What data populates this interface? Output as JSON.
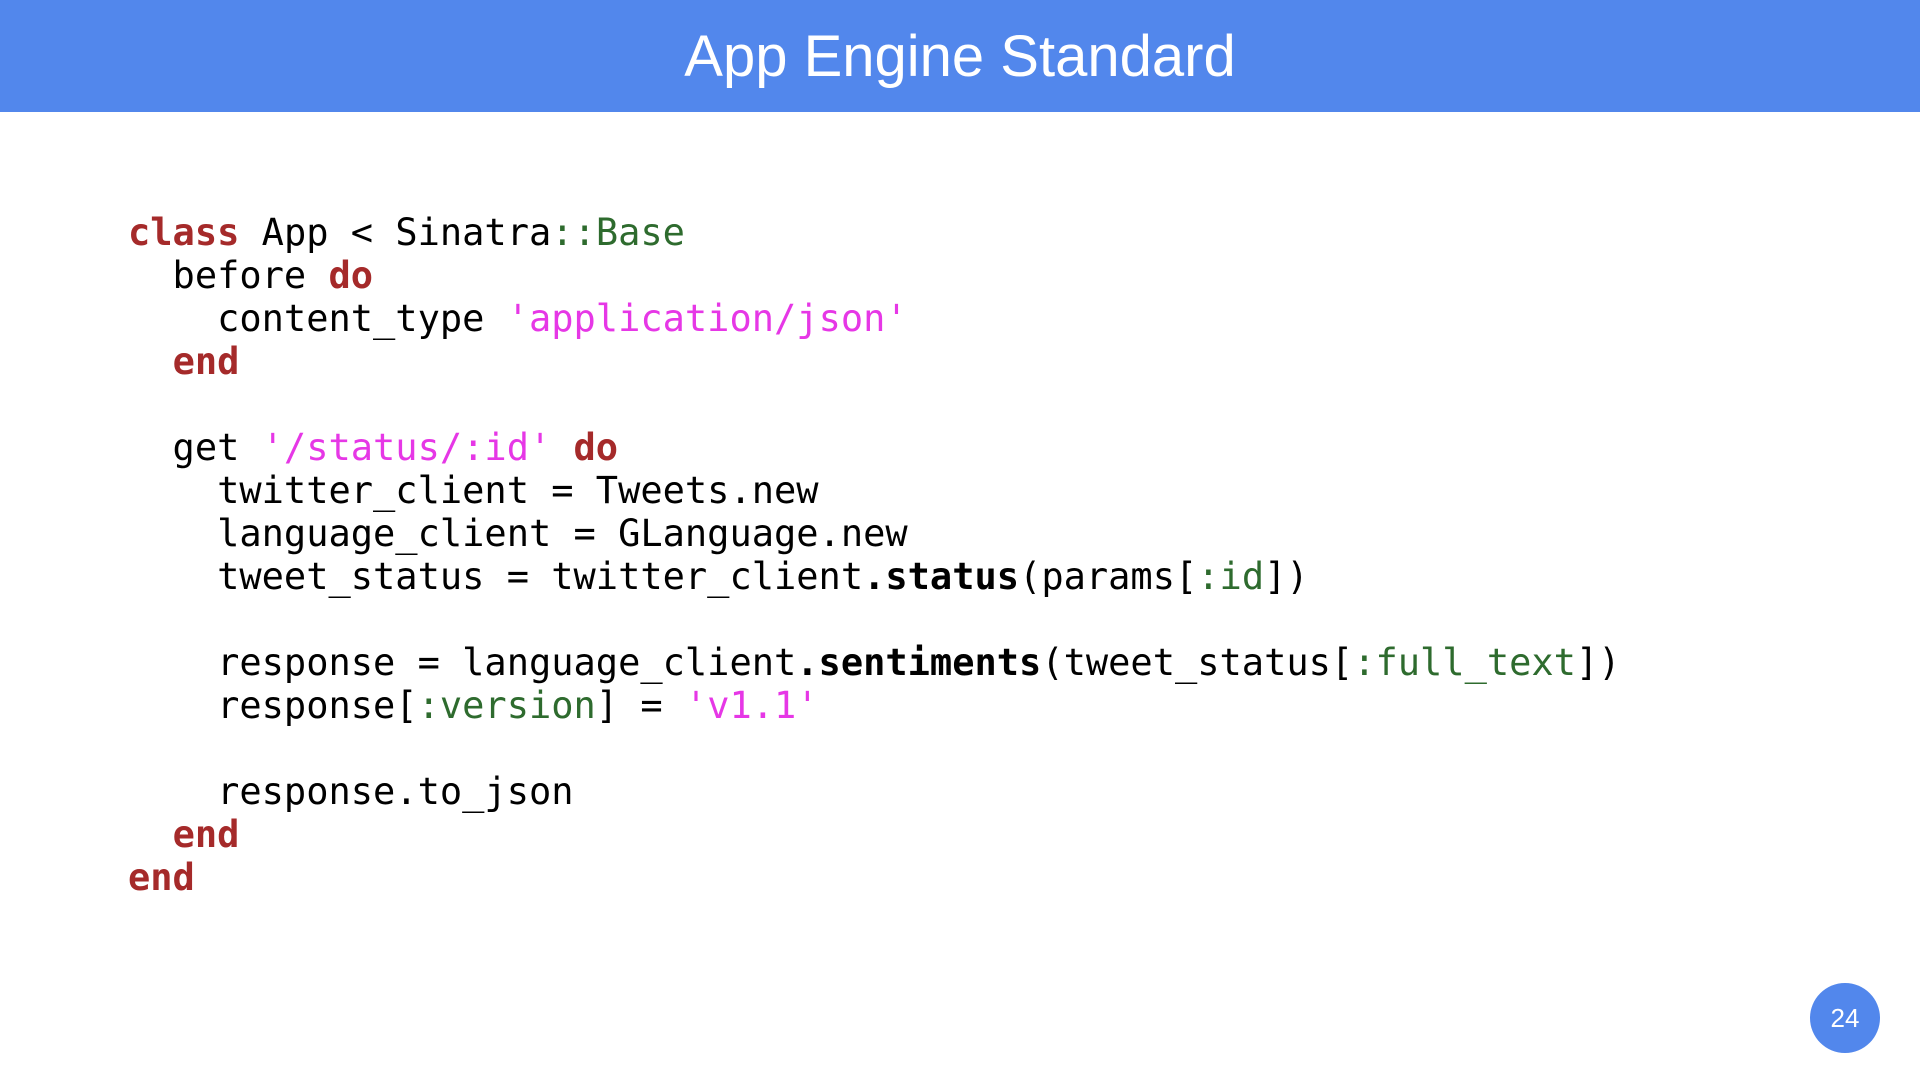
{
  "slide": {
    "title": "App Engine Standard",
    "page_number": "24",
    "colors": {
      "header_bg": "#5287ec",
      "keyword": "#a52a2a",
      "string": "#e637e6",
      "symbol": "#2e6b2e"
    }
  },
  "code": {
    "language": "ruby",
    "lines": [
      [
        {
          "t": "class",
          "k": "kw"
        },
        {
          "t": " App < Sinatra",
          "k": "p"
        },
        {
          "t": "::Base",
          "k": "sym"
        }
      ],
      [
        {
          "t": "  before ",
          "k": "p"
        },
        {
          "t": "do",
          "k": "kw"
        }
      ],
      [
        {
          "t": "    content_type ",
          "k": "p"
        },
        {
          "t": "'application/json'",
          "k": "str"
        }
      ],
      [
        {
          "t": "  ",
          "k": "p"
        },
        {
          "t": "end",
          "k": "kw"
        }
      ],
      [],
      [
        {
          "t": "  get ",
          "k": "p"
        },
        {
          "t": "'/status/:id'",
          "k": "str"
        },
        {
          "t": " ",
          "k": "p"
        },
        {
          "t": "do",
          "k": "kw"
        }
      ],
      [
        {
          "t": "    twitter_client = Tweets.new",
          "k": "p"
        }
      ],
      [
        {
          "t": "    language_client = GLanguage.new",
          "k": "p"
        }
      ],
      [
        {
          "t": "    tweet_status = twitter_client",
          "k": "p"
        },
        {
          "t": ".status",
          "k": "meth"
        },
        {
          "t": "(params[",
          "k": "p"
        },
        {
          "t": ":id",
          "k": "sym"
        },
        {
          "t": "])",
          "k": "p"
        }
      ],
      [],
      [
        {
          "t": "    response = language_client",
          "k": "p"
        },
        {
          "t": ".sentiments",
          "k": "meth"
        },
        {
          "t": "(tweet_status[",
          "k": "p"
        },
        {
          "t": ":full_text",
          "k": "sym"
        },
        {
          "t": "])",
          "k": "p"
        }
      ],
      [
        {
          "t": "    response[",
          "k": "p"
        },
        {
          "t": ":version",
          "k": "sym"
        },
        {
          "t": "] = ",
          "k": "p"
        },
        {
          "t": "'v1.1'",
          "k": "str"
        }
      ],
      [],
      [
        {
          "t": "    response.to_json",
          "k": "p"
        }
      ],
      [
        {
          "t": "  ",
          "k": "p"
        },
        {
          "t": "end",
          "k": "kw"
        }
      ],
      [
        {
          "t": "end",
          "k": "kw"
        }
      ]
    ]
  }
}
